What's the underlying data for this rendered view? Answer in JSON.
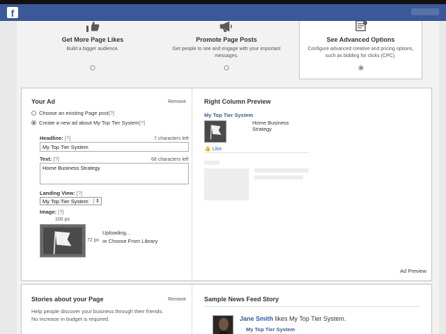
{
  "header": {
    "logo": "f"
  },
  "objectives": [
    {
      "title": "Get More Page Likes",
      "desc": "Build a bigger audience.",
      "icon": "thumbs-up-icon"
    },
    {
      "title": "Promote Page Posts",
      "desc": "Get people to see and engage with your important messages.",
      "icon": "megaphone-icon"
    },
    {
      "title": "See Advanced Options",
      "desc": "Configure advanced creative and pricing options, such as bidding for clicks (CPC).",
      "icon": "gear-list-icon"
    }
  ],
  "your_ad": {
    "title": "Your Ad",
    "remove": "Remove",
    "option_existing": "Choose an existing Page post",
    "option_new": "Create a new ad about My Top Tier System",
    "help": "[?]",
    "headline_label": "Headline:",
    "headline_count": "7 characters left",
    "headline_value": "My Top Tier System",
    "text_label": "Text:",
    "text_count": "68 characters left",
    "text_value": "Home Business Strategy",
    "landing_label": "Landing View:",
    "landing_value": "My Top Tier System",
    "image_label": "Image:",
    "image_width": "100 px",
    "image_height": "72 px",
    "uploading": "Uploading...",
    "or_choose": "or Choose From Library"
  },
  "preview": {
    "title": "Right Column Preview",
    "ad_title": "My Top Tier System",
    "ad_text": "Home Business Strategy",
    "like": "Like",
    "ad_preview_link": "Ad Preview"
  },
  "stories": {
    "title": "Stories about your Page",
    "remove": "Remove",
    "desc": "Help people discover your business through their friends. No increase in budget is required."
  },
  "sample": {
    "title": "Sample News Feed Story",
    "user": "Jane Smith",
    "likes_text": "likes My Top Tier System.",
    "page_name": "My Top Tier System"
  }
}
